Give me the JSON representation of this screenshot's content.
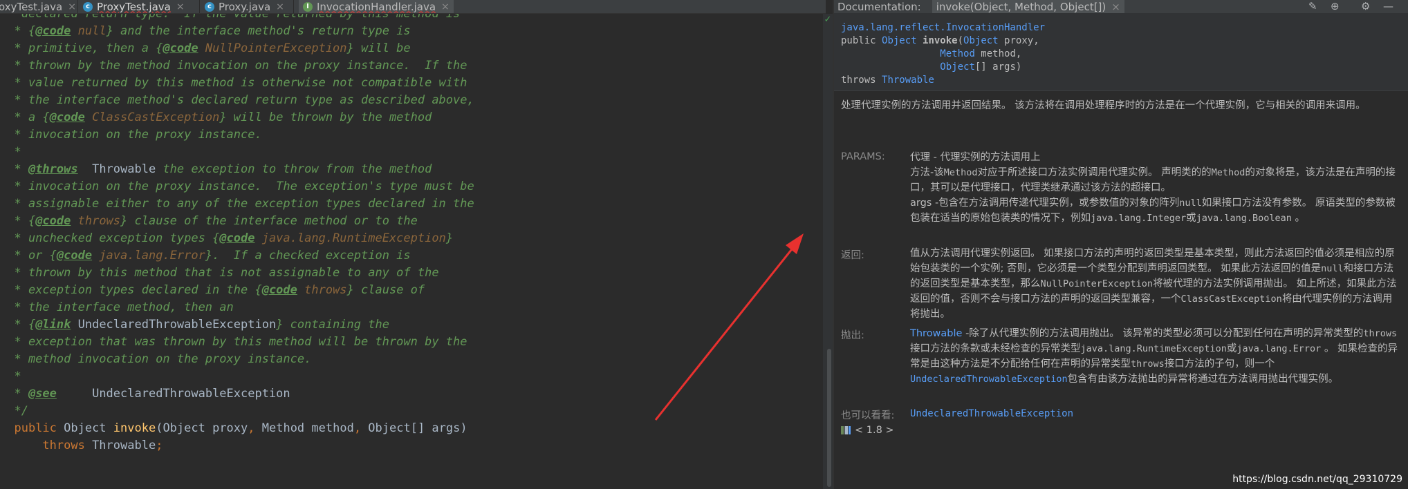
{
  "tabs": [
    {
      "name": "oxyTest.java",
      "close": "×"
    },
    {
      "name": "ProxyTest.java",
      "close": "×"
    },
    {
      "name": "Proxy.java",
      "close": "×"
    },
    {
      "name": "InvocationHandler.java",
      "close": "×"
    }
  ],
  "editor": {
    "lines": [
      [
        {
          "c": "doc",
          "t": "   declared return type.  If the value returned by this method is"
        }
      ],
      [
        {
          "c": "doc",
          "t": "  * {"
        },
        {
          "c": "tag",
          "t": "@code"
        },
        {
          "c": "ref",
          "t": " null"
        },
        {
          "c": "doc",
          "t": "} and the interface method's return type is"
        }
      ],
      [
        {
          "c": "doc",
          "t": "  * primitive, then a {"
        },
        {
          "c": "tag",
          "t": "@code"
        },
        {
          "c": "ref",
          "t": " NullPointerException"
        },
        {
          "c": "doc",
          "t": "} will be"
        }
      ],
      [
        {
          "c": "doc",
          "t": "  * thrown by the method invocation on the proxy instance.  If the"
        }
      ],
      [
        {
          "c": "doc",
          "t": "  * value returned by this method is otherwise not compatible with"
        }
      ],
      [
        {
          "c": "doc",
          "t": "  * the interface method's declared return type as described above,"
        }
      ],
      [
        {
          "c": "doc",
          "t": "  * a {"
        },
        {
          "c": "tag",
          "t": "@code"
        },
        {
          "c": "ref",
          "t": " ClassCastException"
        },
        {
          "c": "doc",
          "t": "} will be thrown by the method"
        }
      ],
      [
        {
          "c": "doc",
          "t": "  * invocation on the proxy instance."
        }
      ],
      [
        {
          "c": "doc",
          "t": "  *"
        }
      ],
      [
        {
          "c": "doc",
          "t": "  * "
        },
        {
          "c": "tag",
          "t": "@throws"
        },
        {
          "c": "plain",
          "t": "  Throwable"
        },
        {
          "c": "doc",
          "t": " the exception to throw from the method"
        }
      ],
      [
        {
          "c": "doc",
          "t": "  * invocation on the proxy instance.  The exception's type must be"
        }
      ],
      [
        {
          "c": "doc",
          "t": "  * assignable either to any of the exception types declared in the"
        }
      ],
      [
        {
          "c": "doc",
          "t": "  * {"
        },
        {
          "c": "tag",
          "t": "@code"
        },
        {
          "c": "ref",
          "t": " throws"
        },
        {
          "c": "doc",
          "t": "} clause of the interface method or to the"
        }
      ],
      [
        {
          "c": "doc",
          "t": "  * unchecked exception types {"
        },
        {
          "c": "tag",
          "t": "@code"
        },
        {
          "c": "ref",
          "t": " java.lang.RuntimeException"
        },
        {
          "c": "doc",
          "t": "}"
        }
      ],
      [
        {
          "c": "doc",
          "t": "  * or {"
        },
        {
          "c": "tag",
          "t": "@code"
        },
        {
          "c": "ref",
          "t": " java.lang.Error"
        },
        {
          "c": "doc",
          "t": "}.  If a checked exception is"
        }
      ],
      [
        {
          "c": "doc",
          "t": "  * thrown by this method that is not assignable to any of the"
        }
      ],
      [
        {
          "c": "doc",
          "t": "  * exception types declared in the {"
        },
        {
          "c": "tag",
          "t": "@code"
        },
        {
          "c": "ref",
          "t": " throws"
        },
        {
          "c": "doc",
          "t": "} clause of"
        }
      ],
      [
        {
          "c": "doc",
          "t": "  * the interface method, then an"
        }
      ],
      [
        {
          "c": "doc",
          "t": "  * {"
        },
        {
          "c": "tag",
          "t": "@link"
        },
        {
          "c": "plain",
          "t": " UndeclaredThrowableException"
        },
        {
          "c": "doc",
          "t": "} containing the"
        }
      ],
      [
        {
          "c": "doc",
          "t": "  * exception that was thrown by this method will be thrown by the"
        }
      ],
      [
        {
          "c": "doc",
          "t": "  * method invocation on the proxy instance."
        }
      ],
      [
        {
          "c": "doc",
          "t": "  *"
        }
      ],
      [
        {
          "c": "doc",
          "t": "  * "
        },
        {
          "c": "tag",
          "t": "@see"
        },
        {
          "c": "plain",
          "t": "     UndeclaredThrowableException"
        }
      ],
      [
        {
          "c": "doc",
          "t": "  */"
        }
      ],
      [
        {
          "c": "kw",
          "t": "  public "
        },
        {
          "c": "plain",
          "t": "Object "
        },
        {
          "c": "fn",
          "t": "invoke"
        },
        {
          "c": "plain",
          "t": "(Object proxy"
        },
        {
          "c": "kw",
          "t": ", "
        },
        {
          "c": "plain",
          "t": "Method method"
        },
        {
          "c": "kw",
          "t": ", "
        },
        {
          "c": "plain",
          "t": "Object[] args)"
        }
      ],
      [
        {
          "c": "kw",
          "t": "      throws "
        },
        {
          "c": "plain",
          "t": "Throwable"
        },
        {
          "c": "kw",
          "t": ";"
        }
      ]
    ]
  },
  "gutter": {
    "status_icon": "check-icon",
    "status_glyph": "✓"
  },
  "doc_header": {
    "label": "Documentation:",
    "tab": "invoke(Object, Method, Object[])",
    "close": "×",
    "icons": [
      {
        "name": "edit-source-icon",
        "glyph": "✎"
      },
      {
        "name": "external-docs-icon",
        "glyph": "⊕"
      },
      {
        "name": "settings-icon",
        "glyph": "⚙"
      },
      {
        "name": "hide-icon",
        "glyph": "—"
      }
    ]
  },
  "doc": {
    "sig_class": "java.lang.reflect.InvocationHandler",
    "sig_public": "public ",
    "sig_ret": "Object",
    "sig_name": " invoke",
    "sig_open": "(",
    "sig_p1_type": "Object",
    "sig_p1_name": " proxy,",
    "sig_indent": "                 ",
    "sig_p2_type": "Method",
    "sig_p2_name": " method,",
    "sig_p3_type": "Object",
    "sig_p3_name": "[] args)",
    "sig_throws": "throws ",
    "sig_throwable": "Throwable",
    "description": "处理代理实例的方法调用并返回结果。 该方法将在调用处理程序时的方法是在一个代理实例，它与相关的调用来调用。",
    "params_label": "PARAMS:",
    "param_proxy": "代理 - 代理实例的方法调用上",
    "param_method_1": "方法-该",
    "param_method_code1": "Method",
    "param_method_2": "对应于所述接口方法实例调用代理实例。 声明类的的",
    "param_method_code2": "Method",
    "param_method_3": "的对象将是，该方法是在声明的接口，其可以是代理接口，代理类继承通过该方法的超接口。",
    "param_args_1": "args -包含在方法调用传递代理实例，或参数值的对象的阵列",
    "param_args_code1": "null",
    "param_args_2": "如果接口方法没有参数。 原语类型的参数被包装在适当的原始包装类的情况下，例如",
    "param_args_code2": "java.lang.Integer",
    "param_args_3": "或",
    "param_args_code3": "java.lang.Boolean",
    "param_args_4": " 。",
    "returns_label": "返回:",
    "returns_1": "值从方法调用代理实例返回。 如果接口方法的声明的返回类型是基本类型，则此方法返回的值必须是相应的原始包装类的一个实例; 否则，它必须是一个类型分配到声明返回类型。 如果此方法返回的值是",
    "returns_code1": "null",
    "returns_2": "和接口方法的返回类型是基本类型，那么",
    "returns_code2": "NullPointerException",
    "returns_3": "将被代理的方法实例调用抛出。 如上所述，如果此方法返回的值，否则不会与接口方法的声明的返回类型兼容，一个",
    "returns_code3": "ClassCastException",
    "returns_4": "将由代理实例的方法调用将抛出。",
    "throws_label": "抛出:",
    "throws_link1": "Throwable",
    "throws_1": " -除了从代理实例的方法调用抛出。 该异常的类型必须可以分配到任何在声明的异常类型的",
    "throws_code1": "throws",
    "throws_2": "接口方法的条款或未经检查的异常类型",
    "throws_code2": "java.lang.RuntimeException",
    "throws_3": "或",
    "throws_code3": "java.lang.Error",
    "throws_4": " 。 如果检查的异常是由这种方法是不分配给任何在声明的异常类型",
    "throws_code4": "throws",
    "throws_5": "接口方法的子句，则一个",
    "throws_link2": "UndeclaredThrowableException",
    "throws_6": "包含有由该方法抛出的异常将通过在方法调用抛出代理实例。",
    "seealso_label": "也可以看看:",
    "seealso_link": "UndeclaredThrowableException",
    "version": "< 1.8 >"
  },
  "watermark": "https://blog.csdn.net/qq_29310729",
  "colors": {
    "annotation_arrow": "#e8312f",
    "doc_comment": "#629755",
    "keyword": "#cc7832",
    "method": "#ffc66d",
    "link": "#589df6"
  }
}
